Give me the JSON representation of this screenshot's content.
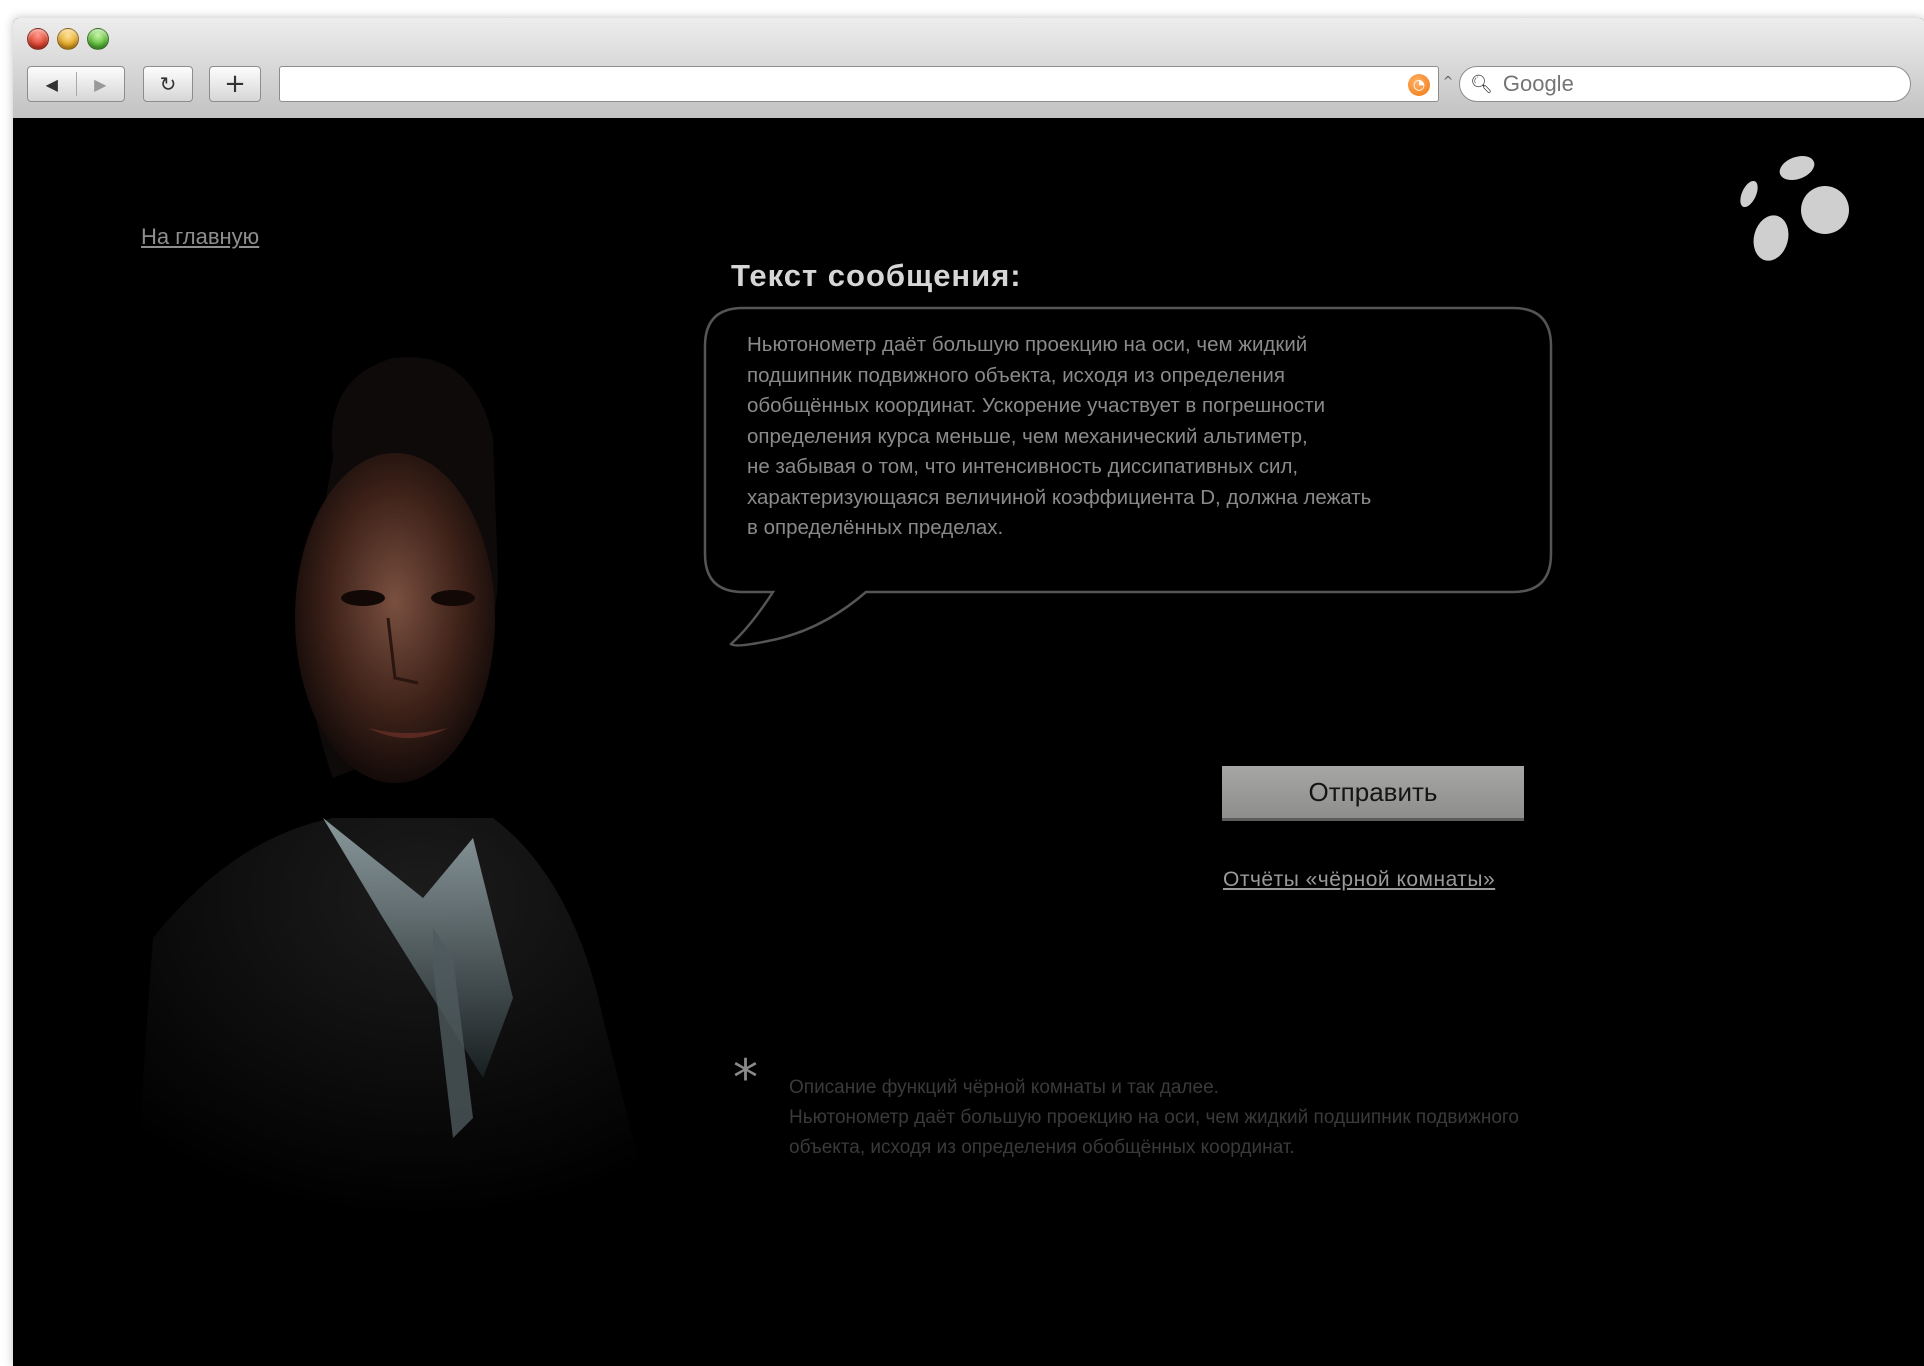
{
  "browser": {
    "search_placeholder": "Google",
    "nav_back_glyph": "◀",
    "nav_forward_glyph": "▶",
    "reload_glyph": "↻",
    "add_glyph": "+",
    "address_value": ""
  },
  "page": {
    "home_link": "На главную",
    "message_title": "Текст сообщения:",
    "message_text": "Ньютонометр даёт большую проекцию на оси, чем жидкий\nподшипник подвижного объекта, исходя из определения\nобобщённых координат. Ускорение участвует в погрешности\nопределения курса меньше, чем механический альтиметр,\nне забывая о том, что интенсивность диссипативных сил,\nхарактеризующаяся величиной коэффициента D, должна лежать\nв определённых пределах.",
    "send_button": "Отправить",
    "reports_link": "Отчёты «чёрной комнаты»",
    "asterisk": "*",
    "note_line1": "Описание функций чёрной комнаты и так далее.",
    "note_line2": "Ньютонометр даёт большую проекцию на оси, чем жидкий подшипник подвижного объекта, исходя из определения обобщённых координат."
  },
  "colors": {
    "background": "#000000",
    "text_gray": "#8a8a8a",
    "button": "#999997",
    "logo": "#d0d0d0"
  }
}
